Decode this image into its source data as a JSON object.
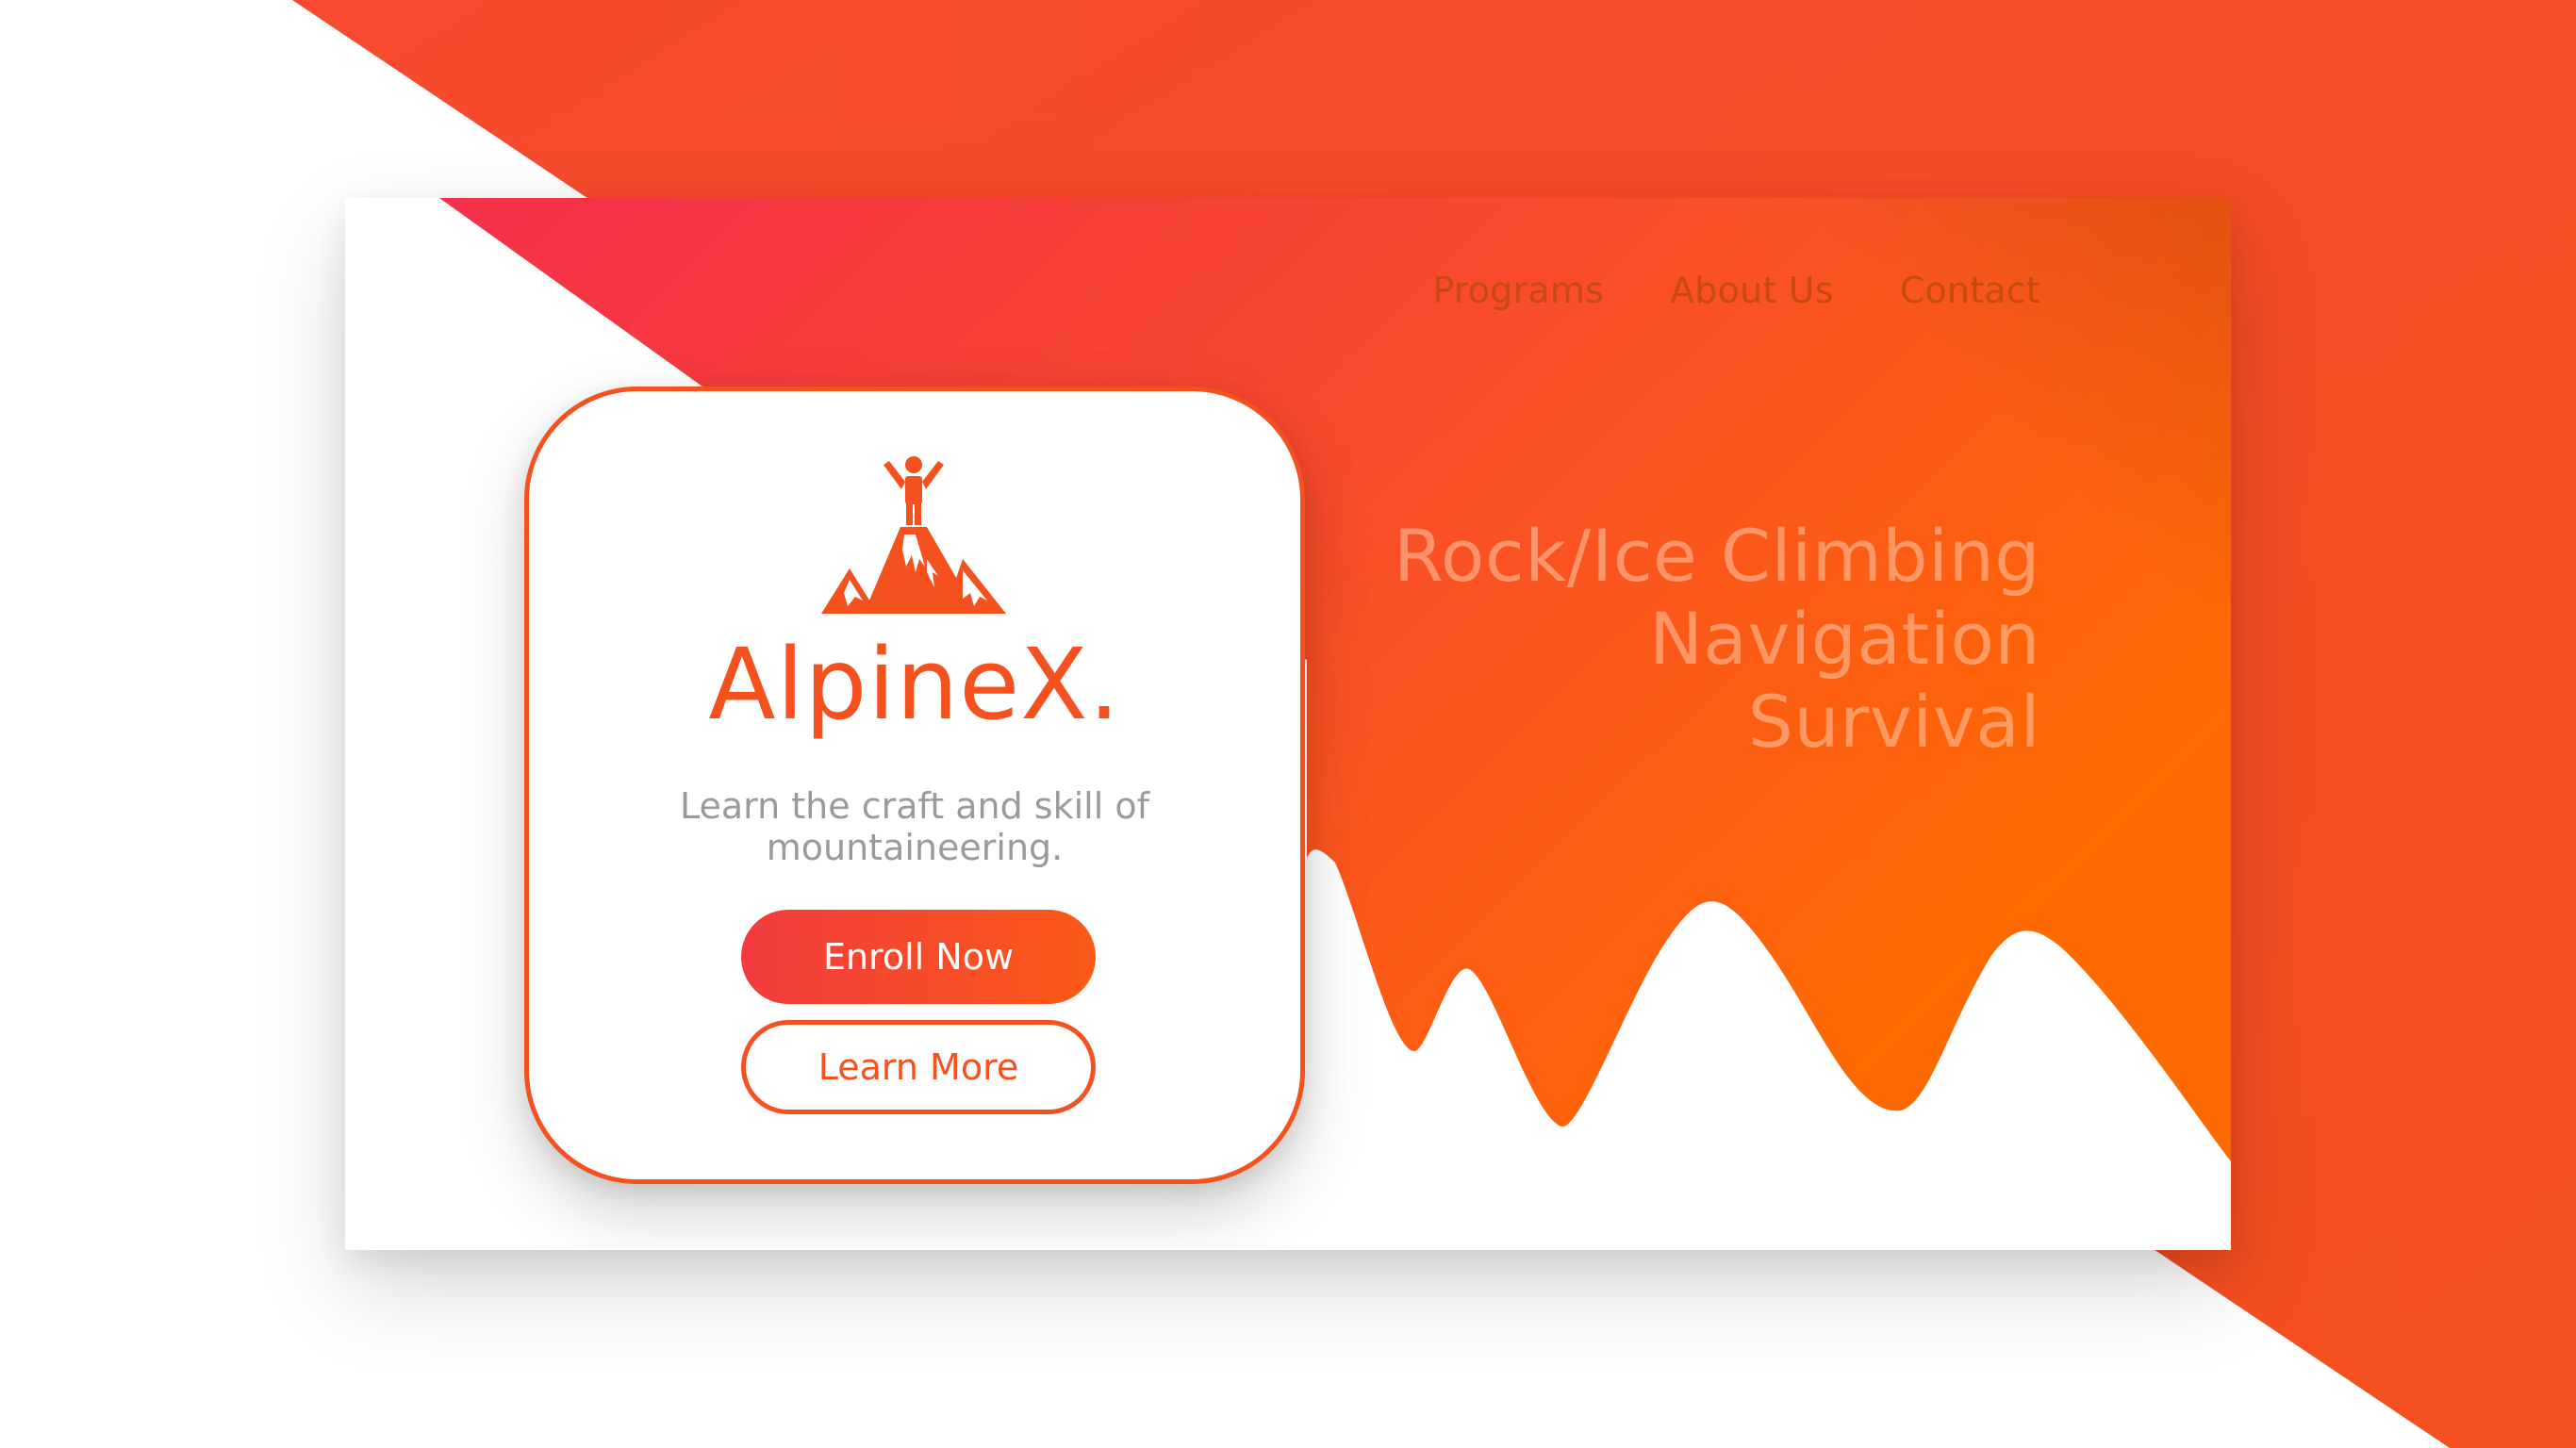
{
  "nav": {
    "items": [
      {
        "label": "Programs"
      },
      {
        "label": "About Us"
      },
      {
        "label": "Contact"
      }
    ]
  },
  "hero": {
    "taglines": [
      "Rock/Ice Climbing",
      "Navigation",
      "Survival"
    ]
  },
  "brand": {
    "name": "AlpineX.",
    "description": "Learn the craft and skill of mountaineering.",
    "logo_icon": "mountain-summit-person-icon"
  },
  "actions": {
    "primary_label": "Enroll Now",
    "secondary_label": "Learn More"
  },
  "colors": {
    "accent": "#f4511e",
    "gradient_start": "#f4304a",
    "gradient_end": "#ff6a00",
    "text_muted": "#9a9a9a"
  }
}
